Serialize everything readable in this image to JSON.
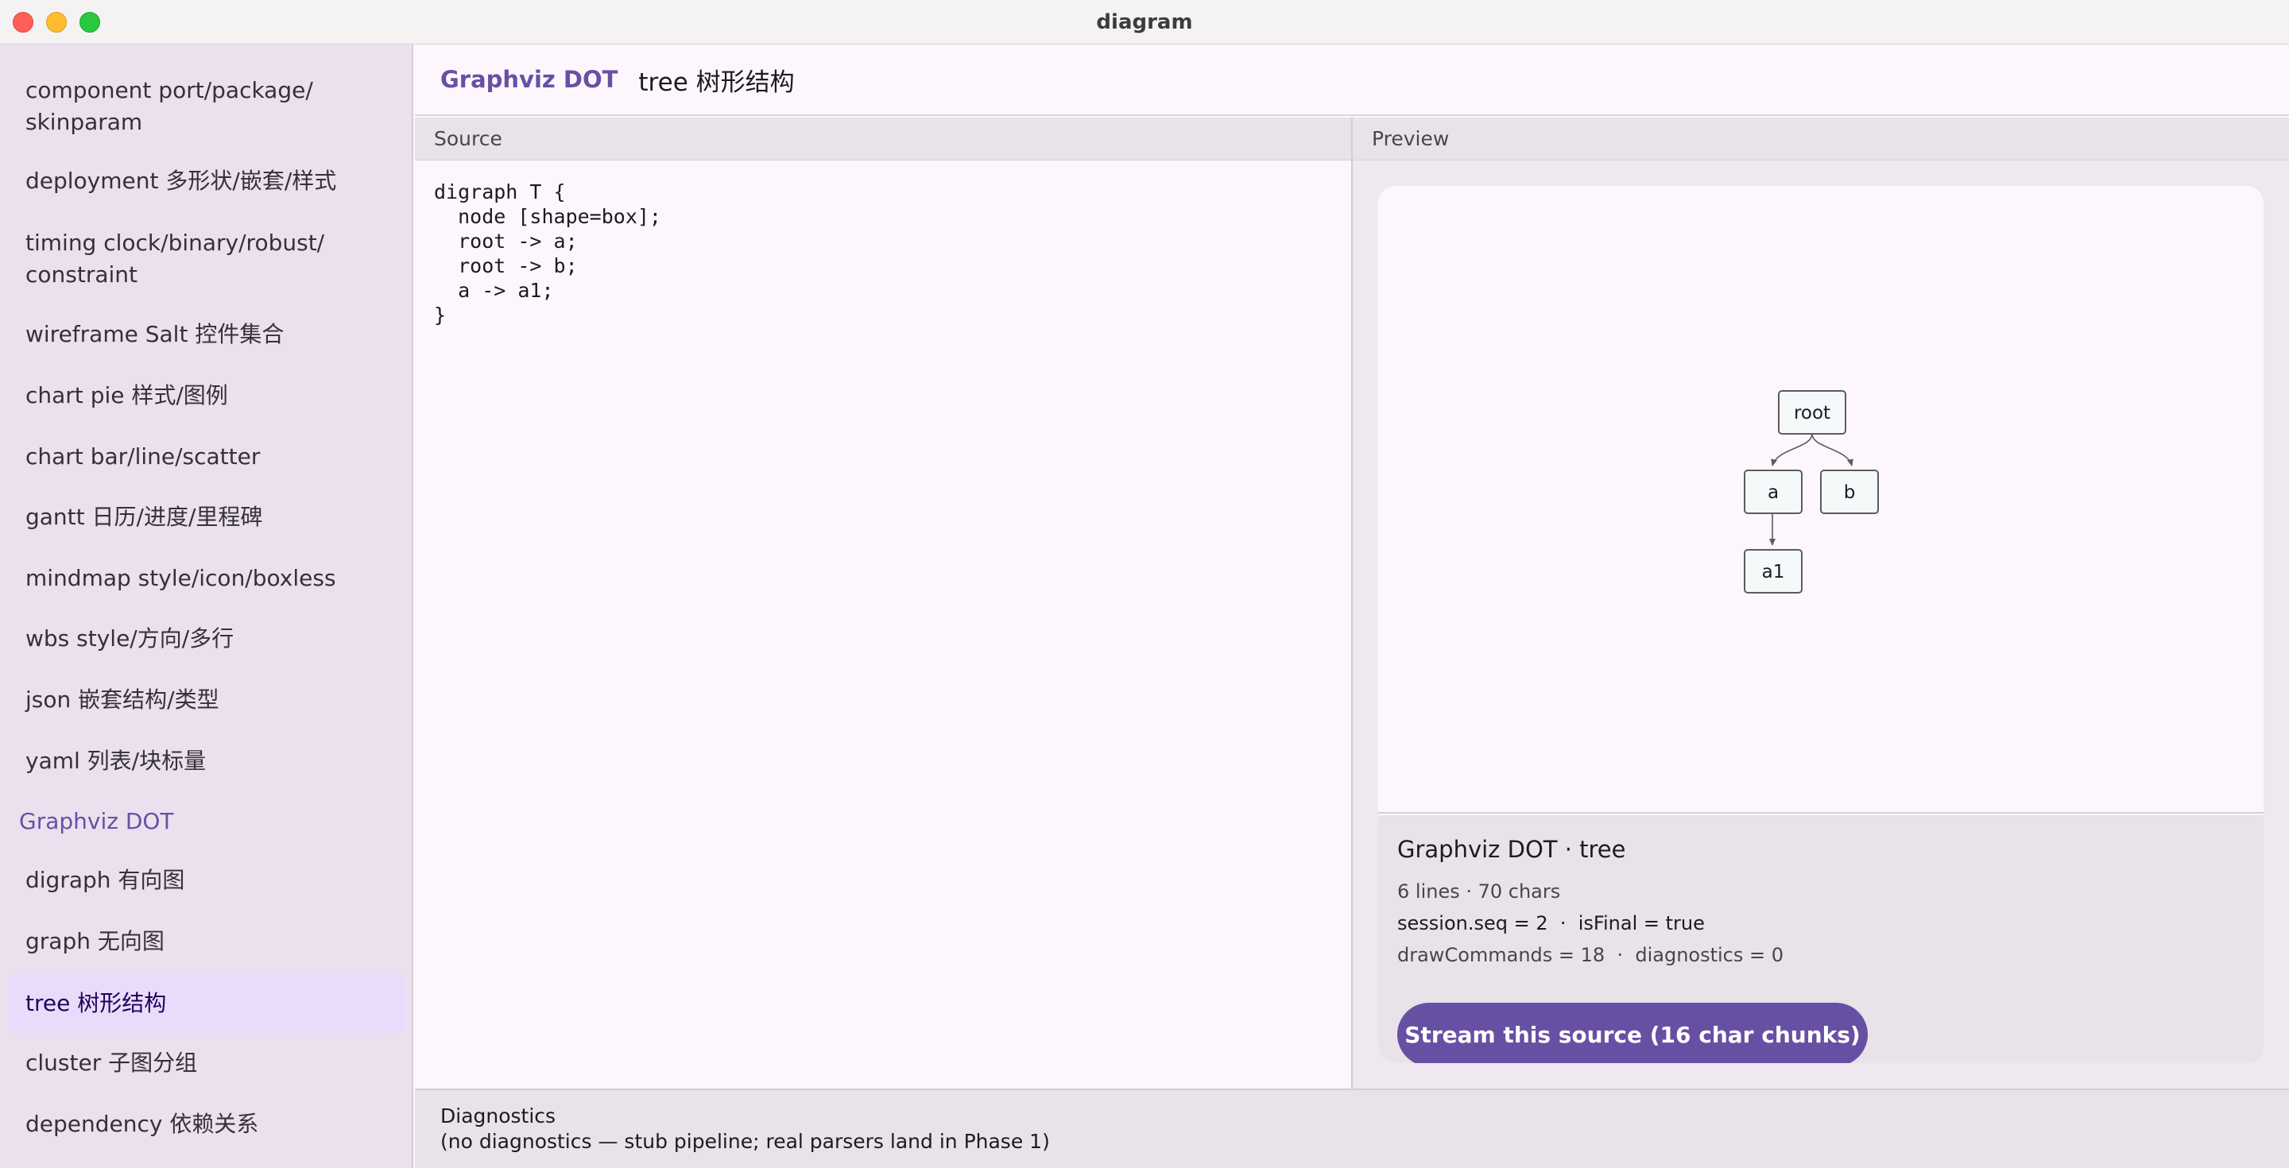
{
  "window": {
    "title": "diagram"
  },
  "sidebar": {
    "items_before": [
      {
        "label": "component port/package/\nskinparam"
      },
      {
        "label": "deployment 多形状/嵌套/样式"
      },
      {
        "label": "timing clock/binary/robust/\nconstraint"
      },
      {
        "label": "wireframe Salt 控件集合"
      },
      {
        "label": "chart pie 样式/图例"
      },
      {
        "label": "chart bar/line/scatter"
      },
      {
        "label": "gantt 日历/进度/里程碑"
      },
      {
        "label": "mindmap style/icon/boxless"
      },
      {
        "label": "wbs style/方向/多行"
      },
      {
        "label": "json 嵌套结构/类型"
      },
      {
        "label": "yaml 列表/块标量"
      }
    ],
    "section": "Graphviz DOT",
    "items_after": [
      {
        "label": "digraph 有向图"
      },
      {
        "label": "graph 无向图"
      },
      {
        "label": "tree 树形结构",
        "selected": true
      },
      {
        "label": "cluster 子图分组"
      },
      {
        "label": "dependency 依赖关系"
      }
    ]
  },
  "header": {
    "group": "Graphviz DOT",
    "title": "tree 树形结构"
  },
  "source": {
    "heading": "Source",
    "code": "digraph T {\n  node [shape=box];\n  root -> a;\n  root -> b;\n  a -> a1;\n}"
  },
  "preview": {
    "heading": "Preview",
    "graph": {
      "nodes": [
        "root",
        "a",
        "b",
        "a1"
      ],
      "edges": [
        [
          "root",
          "a"
        ],
        [
          "root",
          "b"
        ],
        [
          "a",
          "a1"
        ]
      ]
    },
    "info": {
      "title": "Graphviz DOT · tree",
      "stats": "6 lines · 70 chars",
      "session": "session.seq = 2  ·  isFinal = true",
      "draw": "drawCommands = 18  ·  diagnostics = 0"
    },
    "stream_button": "Stream this source (16 char chunks)"
  },
  "diagnostics": {
    "title": "Diagnostics",
    "message": "(no diagnostics — stub pipeline; real parsers land in Phase 1)"
  },
  "colors": {
    "accent": "#6750a4",
    "sidebar_bg": "#ebe0ee",
    "selected_bg": "#e9dcfb"
  }
}
